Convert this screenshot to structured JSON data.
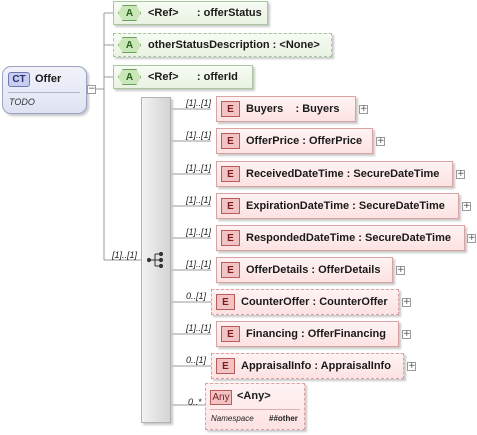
{
  "complex_type": {
    "badge": "CT",
    "name": "Offer",
    "documentation": "TODO"
  },
  "sequence": {
    "cardinality": "[1]..[1]",
    "icon": "sequence-icon"
  },
  "attributes": [
    {
      "badge": "A",
      "text": "<Ref>      : offerStatus",
      "optional": false
    },
    {
      "badge": "A",
      "text": "otherStatusDescription : <None>",
      "optional": true
    },
    {
      "badge": "A",
      "text": "<Ref>      : offerId",
      "optional": false
    }
  ],
  "elements": [
    {
      "badge": "E",
      "cardinality": "[1]..[1]",
      "label": "Buyers    : Buyers",
      "optional": false
    },
    {
      "badge": "E",
      "cardinality": "[1]..[1]",
      "label": "OfferPrice : OfferPrice",
      "optional": false
    },
    {
      "badge": "E",
      "cardinality": "[1]..[1]",
      "label": "ReceivedDateTime : SecureDateTime",
      "optional": false
    },
    {
      "badge": "E",
      "cardinality": "[1]..[1]",
      "label": "ExpirationDateTime : SecureDateTime",
      "optional": false
    },
    {
      "badge": "E",
      "cardinality": "[1]..[1]",
      "label": "RespondedDateTime : SecureDateTime",
      "optional": false
    },
    {
      "badge": "E",
      "cardinality": "[1]..[1]",
      "label": "OfferDetails : OfferDetails",
      "optional": false
    },
    {
      "badge": "E",
      "cardinality": "0..[1]",
      "label": "CounterOffer : CounterOffer",
      "optional": true
    },
    {
      "badge": "E",
      "cardinality": "[1]..[1]",
      "label": "Financing : OfferFinancing",
      "optional": false
    },
    {
      "badge": "E",
      "cardinality": "0..[1]",
      "label": "AppraisalInfo : AppraisalInfo",
      "optional": true
    }
  ],
  "any": {
    "badge": "Any",
    "name": "<Any>",
    "cardinality": "0..*",
    "namespace_label": "Namespace",
    "namespace_value": "##other"
  },
  "expand_symbol": "+",
  "collapse_symbol": "−"
}
